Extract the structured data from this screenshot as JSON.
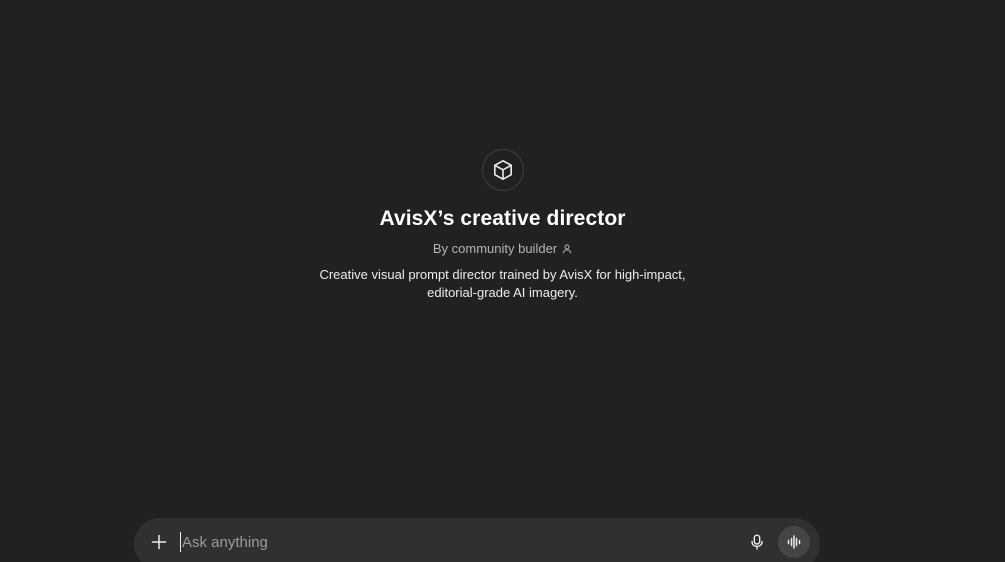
{
  "gpt": {
    "icon": "cube-icon",
    "title": "AvisX’s creative director",
    "byline": "By community builder",
    "byline_icon": "person-icon",
    "description": "Creative visual prompt director trained by AvisX for high-impact, editorial-grade AI imagery."
  },
  "composer": {
    "placeholder": "Ask anything",
    "value": "",
    "add_icon": "plus-icon",
    "mic_icon": "microphone-icon",
    "voice_icon": "voice-waveform-icon"
  },
  "colors": {
    "background": "#212121",
    "composer_background": "#303030",
    "voice_button_background": "#454545",
    "title": "#ffffff",
    "byline": "#b4b4b4",
    "text": "#ececec"
  }
}
